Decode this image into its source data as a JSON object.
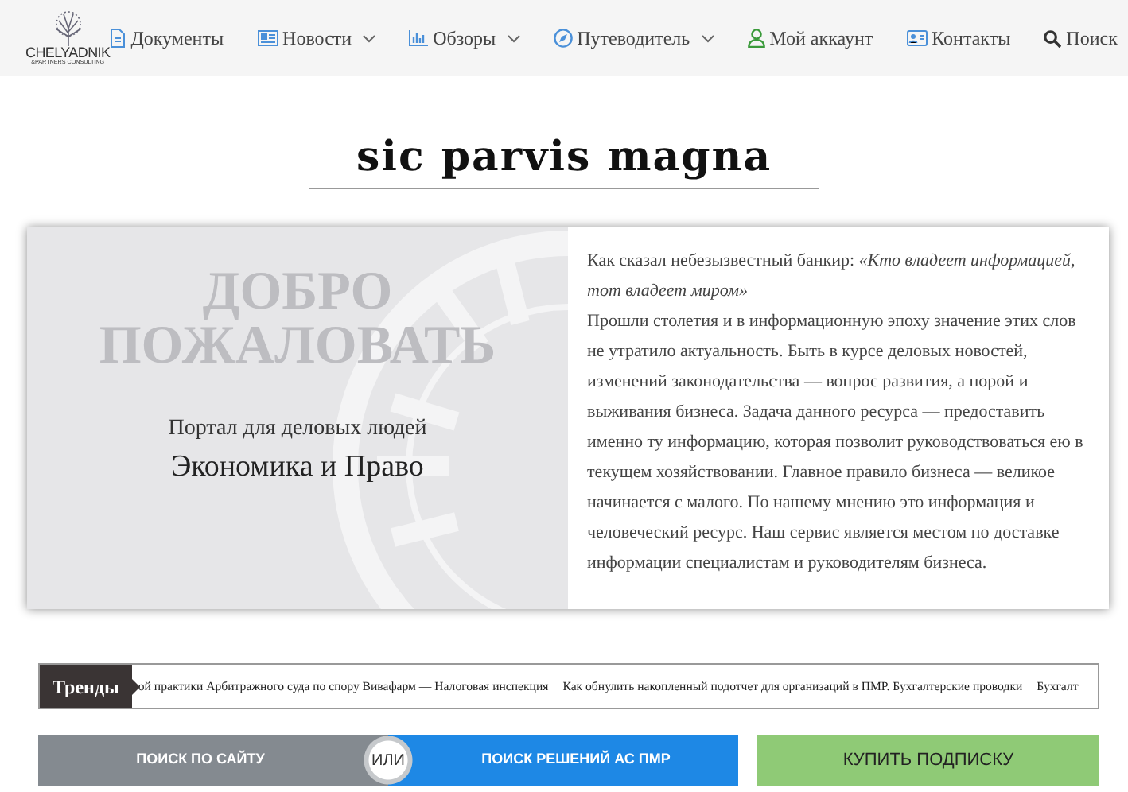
{
  "logo": {
    "name": "CHELYADNIK",
    "tagline": "&PARTNERS CONSULTING"
  },
  "nav": [
    {
      "label": "Документы",
      "dropdown": false
    },
    {
      "label": "Новости",
      "dropdown": true
    },
    {
      "label": "Обзоры",
      "dropdown": true
    },
    {
      "label": "Путеводитель",
      "dropdown": true
    },
    {
      "label": "Мой аккаунт",
      "dropdown": false
    },
    {
      "label": "Контакты",
      "dropdown": false
    },
    {
      "label": "Поиск",
      "dropdown": false
    }
  ],
  "motto": "sic parvis magna",
  "hero": {
    "watermark": "ДОБРО ПОЖАЛОВАТЬ",
    "subtitle": "Портал для деловых людей",
    "title": "Экономика и Право"
  },
  "intro": {
    "quote": "Как сказал небезызвестный банкир: *«Кто владеет информацией, тот владеет миром»*",
    "text": "Прошли столетия и в информационную эпоху значение этих слов не утратило актуальность. Быть в курсе деловых новостей, изменений законодательства — вопрос развития, а порой и выживания бизнеса. Задача данного ресурса — предоставить именно ту информацию, которая позволит руководствоваться ею в текущем хозяйствовании. Главное правило бизнеса — великое начинается с малого. По нашему мнению это информация и человеческий ресурс. Наш сервис является местом по доставке информации специалистам и руководителям бизнеса."
  },
  "trends": {
    "label": "Тренды",
    "items": [
      "ой практики Арбитражного суда по спору Вивафарм — Налоговая инспекция",
      "Как обнулить накопленный подотчет для организаций в ПМР. Бухгалтерские проводки",
      "Бухгалт"
    ]
  },
  "buttons": [
    {
      "label": "ПОИСК ПО САЙТУ",
      "kind": "grey"
    },
    {
      "label": "ИЛИ",
      "kind": "or"
    },
    {
      "label": "ПОИСК РЕШЕНИЙ АС ПМР",
      "kind": "blue"
    },
    {
      "label": "КУПИТЬ ПОДПИСКУ",
      "kind": "green"
    }
  ]
}
